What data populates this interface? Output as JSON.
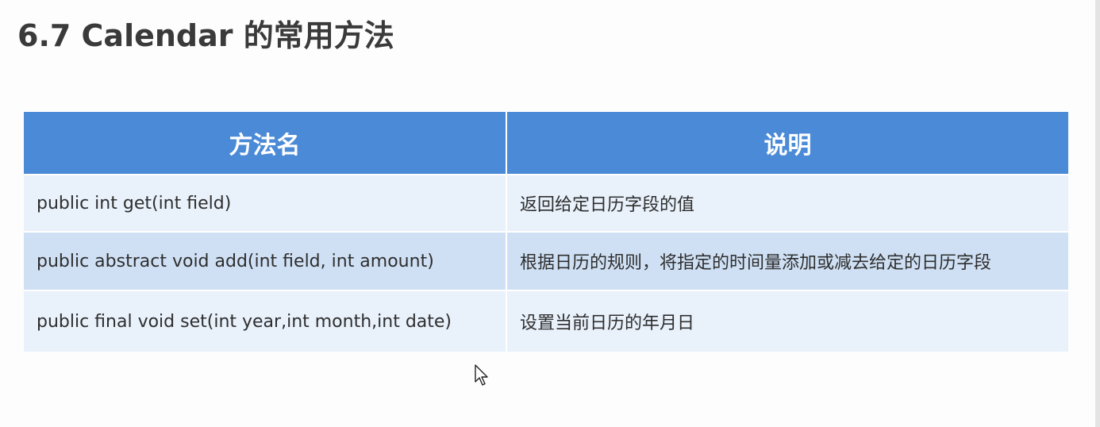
{
  "slide": {
    "title": "6.7 Calendar 的常用方法"
  },
  "table": {
    "headers": [
      "方法名",
      "说明"
    ],
    "rows": [
      {
        "method": "public int get(int field)",
        "description": "返回给定日历字段的值"
      },
      {
        "method": "public abstract void add(int field, int amount)",
        "description": "根据日历的规则，将指定的时间量添加或减去给定的日历字段"
      },
      {
        "method": "public final void set(int year,int month,int date)",
        "description": "设置当前日历的年月日"
      }
    ]
  },
  "colors": {
    "header_bg": "#4a8ad6",
    "row_light": "#e9f1fb",
    "row_dark": "#cfe0f4",
    "title_text": "#3a3a3a"
  },
  "icons": {
    "cursor": "mouse-pointer-icon"
  }
}
